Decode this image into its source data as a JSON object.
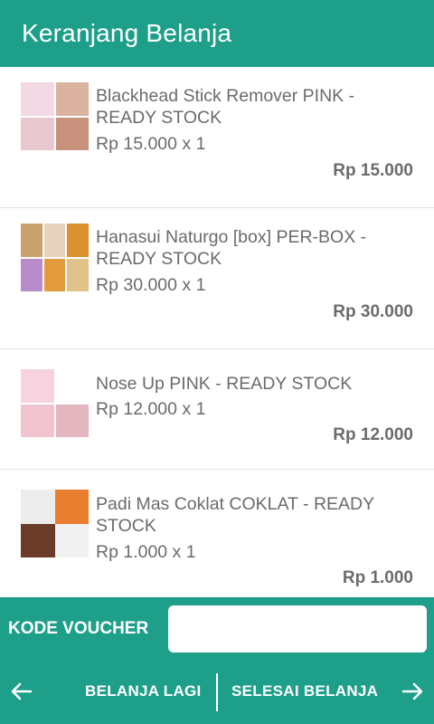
{
  "header": {
    "title": "Keranjang Belanja"
  },
  "items": [
    {
      "name": "Blackhead Stick Remover PINK - READY STOCK",
      "price_qty": "Rp 15.000 x 1",
      "total": "Rp 15.000",
      "thumb_colors": [
        "#f3d9e3",
        "#d9b2a0",
        "#e8c9cf",
        "#c7917b"
      ]
    },
    {
      "name": "Hanasui Naturgo [box] PER-BOX - READY STOCK",
      "price_qty": "Rp 30.000 x 1",
      "total": "Rp 30.000",
      "thumb_colors": [
        "#c9a36b",
        "#e6d3c0",
        "#d9922f",
        "#b88cc9",
        "#e39a3d",
        "#e0c28a"
      ]
    },
    {
      "name": "Nose Up PINK - READY STOCK",
      "price_qty": "Rp 12.000 x 1",
      "total": "Rp 12.000",
      "thumb_colors": [
        "#f6d3df",
        "#ffffff",
        "#f0c4cf",
        "#e4b7c0"
      ]
    },
    {
      "name": "Padi Mas Coklat COKLAT - READY STOCK",
      "price_qty": "Rp 1.000 x 1",
      "total": "Rp 1.000",
      "thumb_colors": [
        "#ececec",
        "#e97e2f",
        "#6b3b2a",
        "#f1f1f1"
      ]
    }
  ],
  "footer": {
    "voucher_label": "KODE VOUCHER",
    "voucher_value": "",
    "back_label": "BELANJA LAGI",
    "finish_label": "SELESAI BELANJA"
  },
  "colors": {
    "primary": "#1e9f8a",
    "text": "#6b6b6b"
  }
}
